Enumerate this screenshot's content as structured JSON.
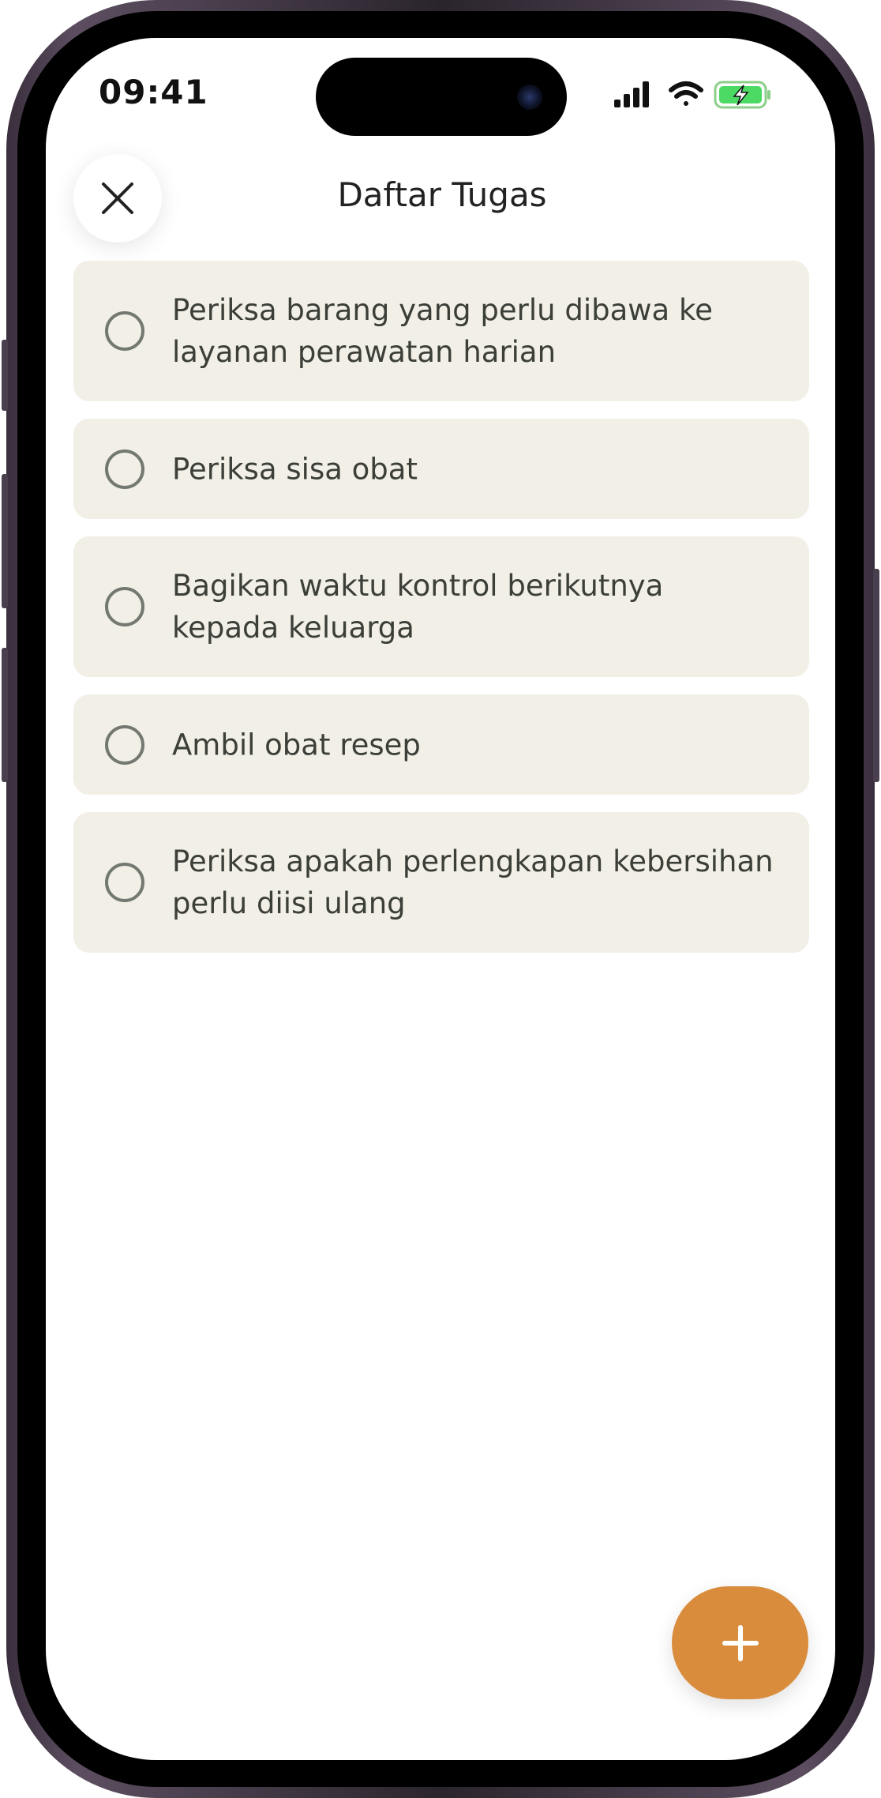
{
  "status_bar": {
    "time": "09:41"
  },
  "header": {
    "title": "Daftar Tugas",
    "close_icon": "close-icon"
  },
  "tasks": [
    {
      "label": "Periksa barang yang perlu dibawa ke layanan perawatan harian",
      "checked": false
    },
    {
      "label": "Periksa sisa obat",
      "checked": false
    },
    {
      "label": "Bagikan waktu kontrol berikutnya kepada keluarga",
      "checked": false
    },
    {
      "label": "Ambil obat resep",
      "checked": false
    },
    {
      "label": "Periksa apakah perlengkapan kebersihan perlu diisi ulang",
      "checked": false
    }
  ],
  "fab": {
    "icon": "plus-icon"
  },
  "colors": {
    "task_background": "#f1efe6",
    "task_text": "#3b3f38",
    "radio_border": "#737870",
    "fab_background": "#d98c3c",
    "battery_green": "#4cd964"
  }
}
